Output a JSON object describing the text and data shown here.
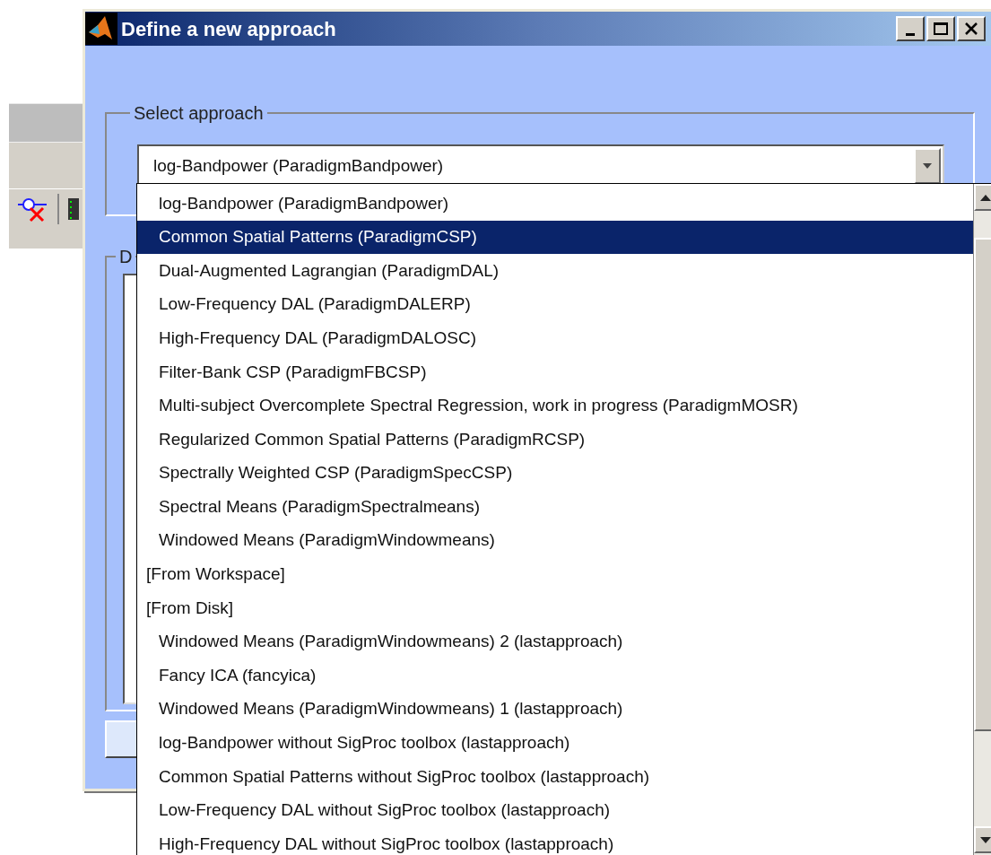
{
  "window": {
    "title": "Define a new approach"
  },
  "select_group": {
    "label": "Select approach",
    "combo_value": "log-Bandpower (ParadigmBandpower)"
  },
  "description_group": {
    "label": "D"
  },
  "dropdown": {
    "items": [
      {
        "label": "log-Bandpower (ParadigmBandpower)",
        "kind": "item",
        "selected": false
      },
      {
        "label": "Common Spatial Patterns (ParadigmCSP)",
        "kind": "item",
        "selected": true
      },
      {
        "label": "Dual-Augmented Lagrangian (ParadigmDAL)",
        "kind": "item",
        "selected": false
      },
      {
        "label": "Low-Frequency DAL (ParadigmDALERP)",
        "kind": "item",
        "selected": false
      },
      {
        "label": "High-Frequency DAL (ParadigmDALOSC)",
        "kind": "item",
        "selected": false
      },
      {
        "label": "Filter-Bank CSP (ParadigmFBCSP)",
        "kind": "item",
        "selected": false
      },
      {
        "label": "Multi-subject Overcomplete Spectral Regression, work in progress (ParadigmMOSR)",
        "kind": "item",
        "selected": false
      },
      {
        "label": "Regularized Common Spatial Patterns (ParadigmRCSP)",
        "kind": "item",
        "selected": false
      },
      {
        "label": "Spectrally Weighted CSP (ParadigmSpecCSP)",
        "kind": "item",
        "selected": false
      },
      {
        "label": "Spectral Means (ParadigmSpectralmeans)",
        "kind": "item",
        "selected": false
      },
      {
        "label": "Windowed Means (ParadigmWindowmeans)",
        "kind": "item",
        "selected": false
      },
      {
        "label": "[From Workspace]",
        "kind": "header",
        "selected": false
      },
      {
        "label": "[From Disk]",
        "kind": "header",
        "selected": false
      },
      {
        "label": "Windowed Means (ParadigmWindowmeans) 2 (lastapproach)",
        "kind": "item",
        "selected": false
      },
      {
        "label": "Fancy ICA (fancyica)",
        "kind": "item",
        "selected": false
      },
      {
        "label": "Windowed Means (ParadigmWindowmeans) 1 (lastapproach)",
        "kind": "item",
        "selected": false
      },
      {
        "label": "log-Bandpower without SigProc toolbox (lastapproach)",
        "kind": "item",
        "selected": false
      },
      {
        "label": "Common Spatial Patterns without SigProc toolbox (lastapproach)",
        "kind": "item",
        "selected": false
      },
      {
        "label": "Low-Frequency DAL without SigProc toolbox (lastapproach)",
        "kind": "item",
        "selected": false
      },
      {
        "label": "High-Frequency DAL without SigProc toolbox (lastapproach)",
        "kind": "item",
        "selected": false
      }
    ]
  }
}
